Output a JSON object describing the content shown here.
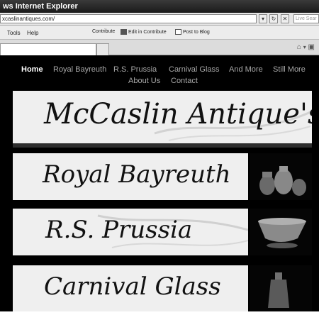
{
  "browser": {
    "title": "ws Internet Explorer",
    "address": "xcaslinantiques.com/",
    "search_placeholder": "Live Sear",
    "menu": [
      "Tools",
      "Help"
    ],
    "toolbar": [
      "Contribute",
      "Edit in Contribute",
      "Post to Blog"
    ]
  },
  "site": {
    "nav": [
      "Home",
      "Royal Bayreuth",
      "R.S. Prussia",
      "Carnival Glass",
      "And More",
      "Still More",
      "About Us",
      "Contact"
    ],
    "header_title": "McCaslin Antique's",
    "categories": [
      "Royal Bayreuth",
      "R.S. Prussia",
      "Carnival Glass"
    ]
  },
  "colors": {
    "page_bg": "#000000",
    "banner_bg": "#efefef",
    "nav_active": "#ffffff",
    "nav_text": "#a8a8a8"
  }
}
